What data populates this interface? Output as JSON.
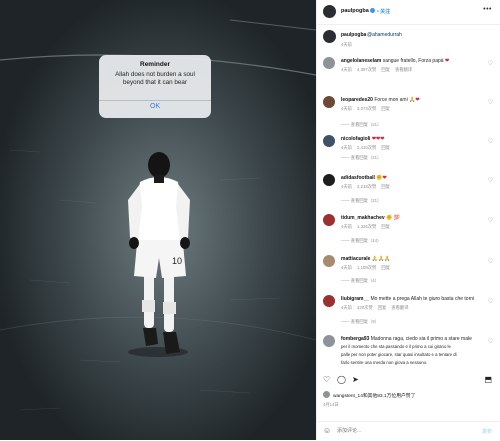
{
  "dialog": {
    "title": "Reminder",
    "message": "Allah does not burden a soul beyond that it can bear",
    "ok": "OK"
  },
  "photo": {
    "shirt_number": "10"
  },
  "header": {
    "username": "paulpogba",
    "follow": "• 关注"
  },
  "caption": {
    "username": "paulpogba",
    "mention": "@ahamedurrah",
    "time": "4天前"
  },
  "comments": [
    {
      "username": "angelolaneselam",
      "text": "sangue  fratello, Forza papà ",
      "emoji": "❤",
      "time": "4天前",
      "likes": "4,397次赞",
      "reply": "回复",
      "translate": "查看翻译",
      "replies": ""
    },
    {
      "username": "leoparedes20",
      "text": "Force mon ami 🙏",
      "emoji": "❤",
      "time": "4天前",
      "likes": "3,073次赞",
      "reply": "回复",
      "translate": "",
      "replies": "—— 查看回复（21）"
    },
    {
      "username": "nicolofagioli",
      "text": "",
      "emoji": "❤❤❤",
      "time": "4天前",
      "likes": "2,410次赞",
      "reply": "回复",
      "translate": "",
      "replies": "—— 查看回复（21）"
    },
    {
      "username": "adidasfootball",
      "text": "",
      "emoji": "✊❤",
      "time": "4天前",
      "likes": "2,218次赞",
      "reply": "回复",
      "translate": "",
      "replies": "—— 查看回复（21）"
    },
    {
      "username": "tidum_makhachev",
      "text": "✊ ",
      "emoji": "💯",
      "time": "4天前",
      "likes": "1,326次赞",
      "reply": "回复",
      "translate": "",
      "replies": "—— 查看回复（14）"
    },
    {
      "username": "mattiacurale",
      "text": "",
      "emoji": "🙏🙏🙏",
      "time": "4天前",
      "likes": "1,109次赞",
      "reply": "回复",
      "translate": "",
      "replies": "—— 查看回复（4）"
    },
    {
      "username": "liubigram__",
      "text": "Mo mette a prega Allah te giuro basta che torni",
      "emoji": "",
      "time": "4天前",
      "likes": "420次赞",
      "reply": "回复",
      "translate": "查看翻译",
      "replies": "—— 查看回复（9）"
    },
    {
      "username": "fomberga93",
      "text": "Madonna raga, ciedo sia il primo a stare male",
      "line2": "per il momento che sta passando e il primo a cui girano le",
      "line3": "palle per non poter giocare, star quasi insultato e a tentare di",
      "line4": "farlo sentire una merda non giova a nessuno.",
      "emoji": "",
      "time": "4天前",
      "likes": "",
      "reply": "",
      "translate": "",
      "replies": ""
    }
  ],
  "actions": {
    "like": "♡",
    "comment": "◯",
    "share": "➤",
    "save": "⬒"
  },
  "likes_line": {
    "prefix": "",
    "user": "stone_14",
    "text": "wangstent_14和其他83.1万位用户赞了"
  },
  "post_date": "4月14日",
  "add_comment": {
    "emoji": "☺",
    "placeholder": "添加评论...",
    "post": "发布"
  }
}
